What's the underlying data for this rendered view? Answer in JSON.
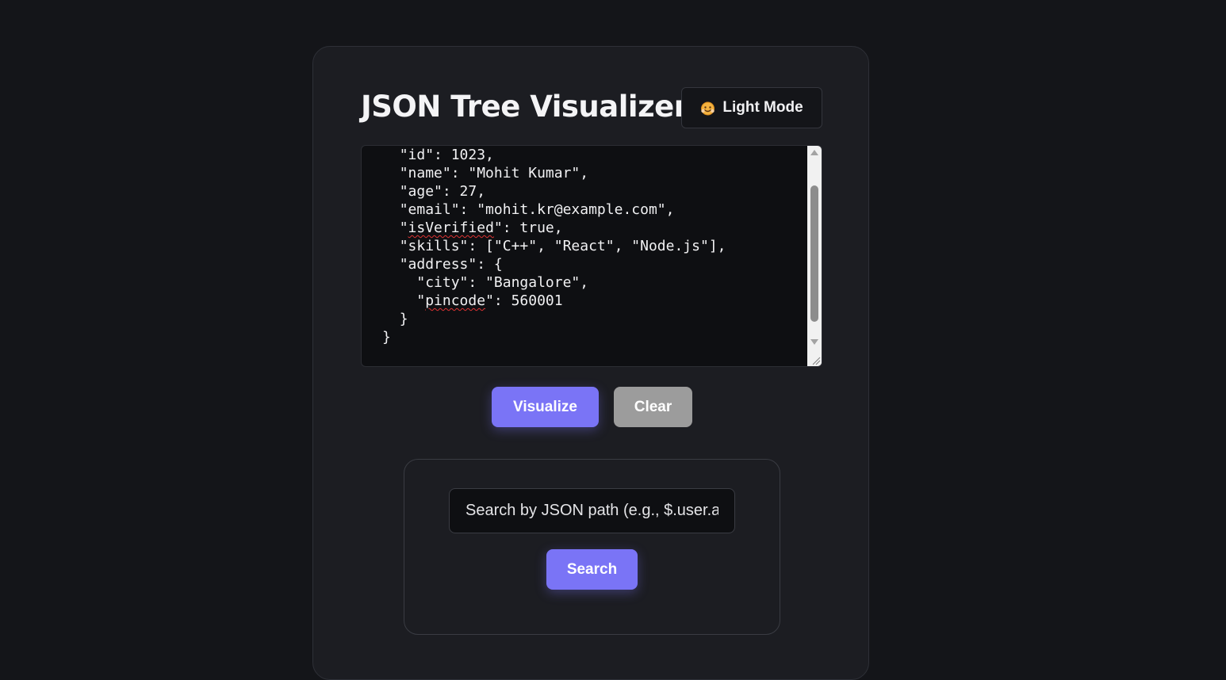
{
  "app": {
    "title": "JSON Tree Visualizer"
  },
  "header": {
    "mode_toggle_label": "Light Mode",
    "mode_toggle_icon": "smiling-face-emoji-icon"
  },
  "editor": {
    "lines": [
      {
        "indent": "  ",
        "pre": "\"id\": 1023,",
        "squiggle": "",
        "post": ""
      },
      {
        "indent": "  ",
        "pre": "\"name\": \"Mohit Kumar\",",
        "squiggle": "",
        "post": ""
      },
      {
        "indent": "  ",
        "pre": "\"age\": 27,",
        "squiggle": "",
        "post": ""
      },
      {
        "indent": "  ",
        "pre": "\"email\": \"mohit.kr@example.com\",",
        "squiggle": "",
        "post": ""
      },
      {
        "indent": "  ",
        "pre": "\"",
        "squiggle": "isVerified",
        "post": "\": true,"
      },
      {
        "indent": "  ",
        "pre": "\"skills\": [\"C++\", \"React\", \"Node.js\"],",
        "squiggle": "",
        "post": ""
      },
      {
        "indent": "  ",
        "pre": "\"address\": {",
        "squiggle": "",
        "post": ""
      },
      {
        "indent": "    ",
        "pre": "\"city\": \"Bangalore\",",
        "squiggle": "",
        "post": ""
      },
      {
        "indent": "    ",
        "pre": "\"",
        "squiggle": "pincode",
        "post": "\": 560001"
      },
      {
        "indent": "  ",
        "pre": "}",
        "squiggle": "",
        "post": ""
      },
      {
        "indent": "",
        "pre": "}",
        "squiggle": "",
        "post": ""
      }
    ]
  },
  "actions": {
    "visualize_label": "Visualize",
    "clear_label": "Clear"
  },
  "search": {
    "placeholder": "Search by JSON path (e.g., $.user.a",
    "value": "",
    "button_label": "Search"
  },
  "colors": {
    "accent": "#7a74f6",
    "clear_button": "#9c9c9c",
    "background": "#141519",
    "card": "#1c1d22"
  }
}
